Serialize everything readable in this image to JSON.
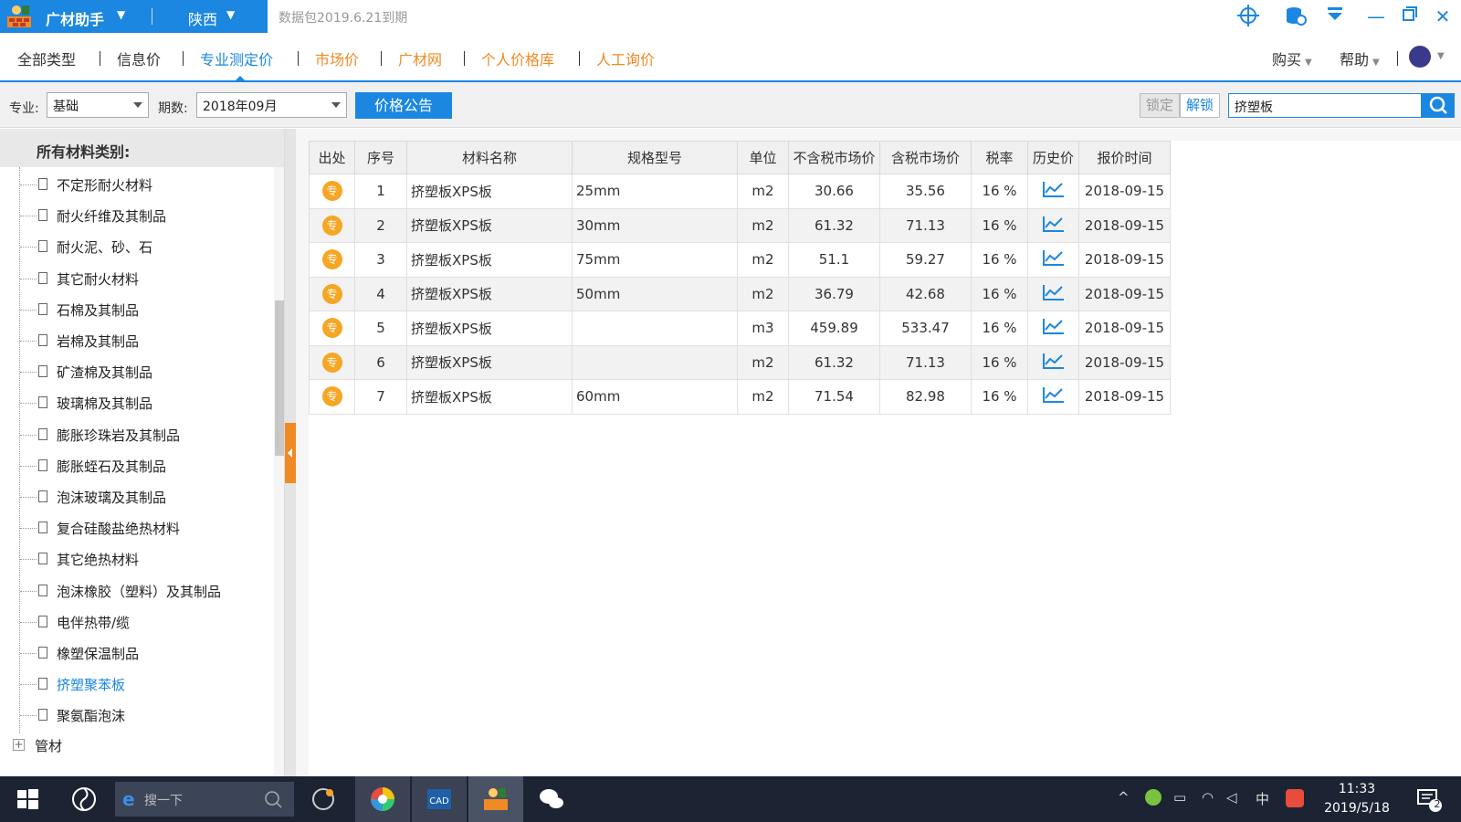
{
  "titlebar": {
    "app_name": "广材助手",
    "region": "陕西",
    "expire_notice": "数据包2019.6.21到期"
  },
  "nav": {
    "items": [
      "全部类型",
      "信息价",
      "专业测定价",
      "市场价",
      "广材网",
      "个人价格库",
      "人工询价"
    ],
    "active_index": 2,
    "buy_label": "购买",
    "help_label": "帮助"
  },
  "filters": {
    "specialty_label": "专业:",
    "specialty_value": "基础",
    "period_label": "期数:",
    "period_value": "2018年09月",
    "notice_button": "价格公告",
    "lock_button": "锁定",
    "unlock_button": "解锁",
    "search_value": "挤塑板"
  },
  "sidebar": {
    "title": "所有材料类别:",
    "items": [
      "不定形耐火材料",
      "耐火纤维及其制品",
      "耐火泥、砂、石",
      "其它耐火材料",
      "石棉及其制品",
      "岩棉及其制品",
      "矿渣棉及其制品",
      "玻璃棉及其制品",
      "膨胀珍珠岩及其制品",
      "膨胀蛭石及其制品",
      "泡沫玻璃及其制品",
      "复合硅酸盐绝热材料",
      "其它绝热材料",
      "泡沫橡胶（塑料）及其制品",
      "电伴热带/缆",
      "橡塑保温制品",
      "挤塑聚苯板",
      "聚氨酯泡沫"
    ],
    "selected_index": 16,
    "group": "管材"
  },
  "table": {
    "headers": [
      "出处",
      "序号",
      "材料名称",
      "规格型号",
      "单位",
      "不含税市场价",
      "含税市场价",
      "税率",
      "历史价",
      "报价时间"
    ],
    "badge": "专",
    "rows": [
      {
        "no": "1",
        "name": "挤塑板XPS板",
        "spec": "25mm",
        "unit": "m2",
        "price_ex": "30.66",
        "price_in": "35.56",
        "tax": "16 %",
        "date": "2018-09-15"
      },
      {
        "no": "2",
        "name": "挤塑板XPS板",
        "spec": "30mm",
        "unit": "m2",
        "price_ex": "61.32",
        "price_in": "71.13",
        "tax": "16 %",
        "date": "2018-09-15"
      },
      {
        "no": "3",
        "name": "挤塑板XPS板",
        "spec": "75mm",
        "unit": "m2",
        "price_ex": "51.1",
        "price_in": "59.27",
        "tax": "16 %",
        "date": "2018-09-15"
      },
      {
        "no": "4",
        "name": "挤塑板XPS板",
        "spec": "50mm",
        "unit": "m2",
        "price_ex": "36.79",
        "price_in": "42.68",
        "tax": "16 %",
        "date": "2018-09-15"
      },
      {
        "no": "5",
        "name": "挤塑板XPS板",
        "spec": "",
        "unit": "m3",
        "price_ex": "459.89",
        "price_in": "533.47",
        "tax": "16 %",
        "date": "2018-09-15"
      },
      {
        "no": "6",
        "name": "挤塑板XPS板",
        "spec": "",
        "unit": "m2",
        "price_ex": "61.32",
        "price_in": "71.13",
        "tax": "16 %",
        "date": "2018-09-15"
      },
      {
        "no": "7",
        "name": "挤塑板XPS板",
        "spec": "60mm",
        "unit": "m2",
        "price_ex": "71.54",
        "price_in": "82.98",
        "tax": "16 %",
        "date": "2018-09-15"
      }
    ]
  },
  "taskbar": {
    "search_placeholder": "搜一下",
    "ime": "中",
    "time": "11:33",
    "date": "2019/5/18",
    "notification_count": "2"
  },
  "colors": {
    "accent": "#1b87e0",
    "orange": "#f08a24",
    "badge": "#f5a623"
  }
}
